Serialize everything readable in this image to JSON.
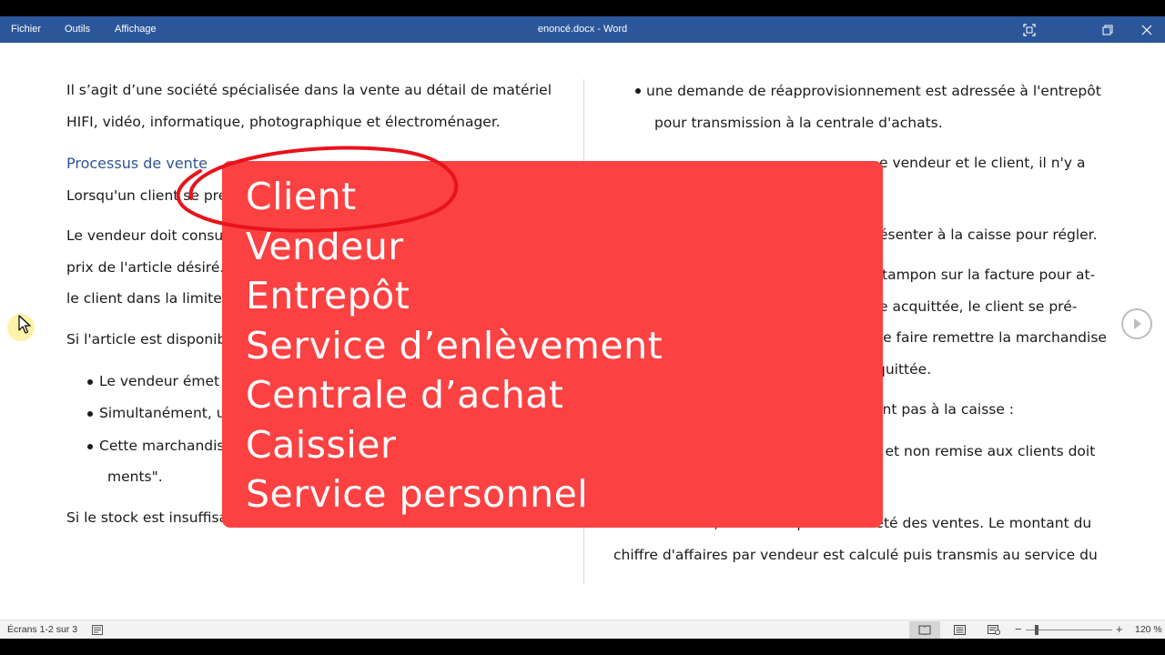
{
  "titlebar": {
    "menus": [
      "Fichier",
      "Outils",
      "Affichage"
    ],
    "title": "enoncé.docx  -  Word",
    "icons": [
      "focus-mode-icon",
      "restore-icon",
      "close-icon"
    ],
    "background": "#2b579a"
  },
  "document": {
    "left": {
      "para1_line1": "Il s’agit d’une société spécialisée dans la vente au détail de matériel",
      "para1_line2": "HIFI, vidéo, informatique, photographique et électroménager.",
      "heading": "Processus de vente",
      "para2": "Lorsqu'un client se pré",
      "para3_line1": "Le vendeur doit consul",
      "para3_line2": "prix de l'article désiré. L",
      "para3_line3": "le client dans la limite d",
      "para4": "Si l'article est disponible",
      "bullet1": "Le vendeur émet u",
      "bullet2": "Simultanément, un",
      "bullet3_line1": "Cette marchandise",
      "bullet3_line2": "ments\".",
      "para5": "Si le stock est insuffisant pour effectuer la vente :"
    },
    "right": {
      "bullet1_line1": "une demande de réapprovisionnement est adressée à l'entrepôt",
      "bullet1_line2": "pour transmission à la centrale d'achats.",
      "line3": "e vendeur et le client, il n'y a",
      "line4": "ésenter à la caisse pour régler.",
      "line5": "tampon sur la facture pour at-",
      "line6": "e acquittée, le client se pré-",
      "line7": "se faire remettre la marchandise",
      "line8": "quittée.",
      "line9": "ent pas à la caisse :",
      "line10": "e et non remise aux clients doit",
      "para_line1": "En fin de mois, la caisse opère un arrêté des ventes. Le montant du",
      "para_line2": "chiffre d'affaires par vendeur est calculé puis transmis au service du"
    },
    "heading_color": "#2f5496"
  },
  "overlay": {
    "color": "#fb4142",
    "items": [
      "Client",
      "Vendeur",
      "Entrepôt",
      "Service d’enlèvement",
      "Centrale d’achat",
      "Caissier",
      "Service personnel"
    ],
    "highlight_color": "#e8131b"
  },
  "nav": {
    "next_icon": "next-page-icon"
  },
  "statusbar": {
    "pages": "Écrans 1-2 sur 3",
    "zoom_minus": "−",
    "zoom_plus": "+",
    "zoom": "120 %"
  }
}
